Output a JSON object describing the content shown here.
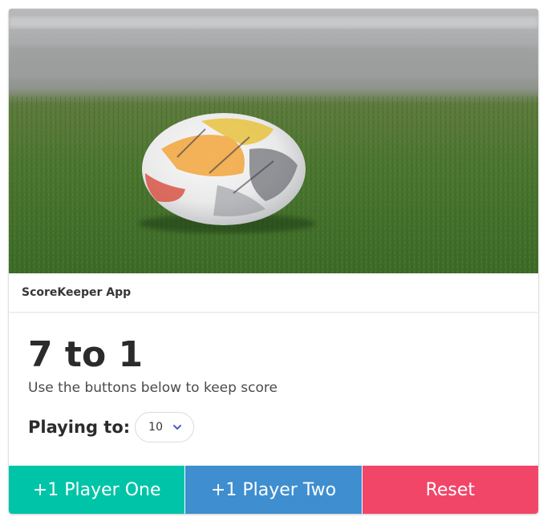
{
  "header": {
    "title": "ScoreKeeper App"
  },
  "image": {
    "description_icon": "soccer-ball-photo"
  },
  "score": {
    "text": "7 to 1",
    "player_one": 7,
    "player_two": 1
  },
  "subtitle": "Use the buttons below to keep score",
  "playing_to": {
    "label": "Playing to:",
    "selected": "10"
  },
  "buttons": {
    "player_one": "+1 Player One",
    "player_two": "+1 Player Two",
    "reset": "Reset"
  },
  "colors": {
    "player_one": "#00c4a7",
    "player_two": "#3e8ed0",
    "reset": "#f14668",
    "chevron": "#485fc7"
  }
}
